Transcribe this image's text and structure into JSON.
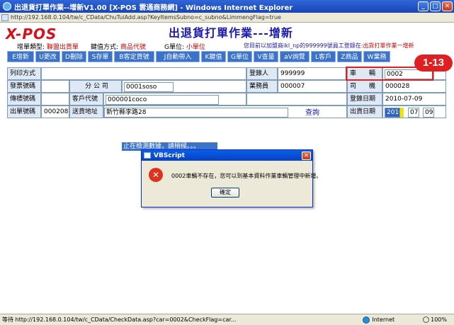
{
  "window": {
    "title": "出退貨打單作業--增新V1.00 [X-POS 雲通商務網] - Windows Internet Explorer",
    "address": "http://192.168.0.104/tw/c_CData/ChuTuiAdd.asp?KeyItemsSubno=c_subno&LimmengFlag=true"
  },
  "header": {
    "logo": "X-POS",
    "page_title": "出退貨打單作業---增新",
    "bill_type_label": "增單類型:",
    "bill_type_value": "聯盟出貨單",
    "key_mode_label": "鍵值方式:",
    "key_mode_value": "商品代號",
    "unit_label": "G單位:",
    "unit_value": "小單位",
    "notice_prefix": "您目前以加盟商ikl_np的999999號員工登錄在:",
    "notice_hl": "出貨打單作業一增新"
  },
  "toolbar": {
    "buttons": [
      "E增新",
      "U更改",
      "D刪除",
      "S存單",
      "B客定貨號",
      "J自動帶入",
      "K鍵值",
      "G單位",
      "V查量",
      "aV詢覽",
      "L客戶",
      "Z商品",
      "W業務"
    ]
  },
  "form": {
    "print_mode_label": "列印方式",
    "registrar_label": "登錄人",
    "registrar_value": "999999",
    "vehicle_label": "車　　輛",
    "vehicle_value": "0002",
    "invoice_no_label": "發票號碼",
    "branch_label": "分 公 司",
    "branch_value": "0001soso",
    "salesman_label": "業務員",
    "salesman_value": "000007",
    "driver_label": "司　　機",
    "driver_value": "000028",
    "voucher_no_label": "傳標號碼",
    "customer_code_label": "客戶代號",
    "customer_code_value": "000001coco",
    "login_date_label": "登錄日期",
    "login_date_value": "2010-07-09",
    "ship_no_label": "出單號碼",
    "ship_no_value": "000208",
    "ship_addr_label": "送貨地址",
    "ship_addr_value": "新竹縣李路28",
    "query_link": "查詢",
    "ship_date_label": "出貨日期",
    "ship_date_year": "2010",
    "ship_date_month": "07",
    "ship_date_day": "09"
  },
  "annotation": {
    "callout": "1-13"
  },
  "loading": {
    "text": "止在檢測數據，請稍候。。。"
  },
  "dialog": {
    "title": "VBScript",
    "message": "0002車輛不存在，您可以到基本資料作業車輛管理中新增。",
    "ok_label": "確定"
  },
  "statusbar": {
    "text": "等待 http://192.168.0.104/tw/c_CData/CheckData.asp?car=0002&CheckFlag=car...",
    "zone": "Internet",
    "zoom": "100%"
  }
}
